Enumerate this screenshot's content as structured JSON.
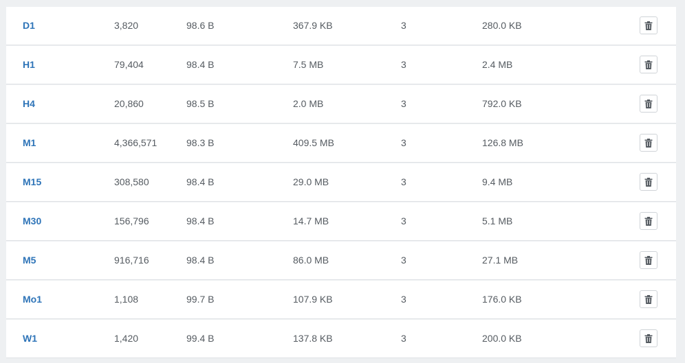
{
  "icons": {
    "delete": "trash-icon"
  },
  "rows": [
    {
      "name": "D1",
      "count": "3,820",
      "avg": "98.6 B",
      "size": "367.9 KB",
      "replicas": "3",
      "disk": "280.0 KB"
    },
    {
      "name": "H1",
      "count": "79,404",
      "avg": "98.4 B",
      "size": "7.5 MB",
      "replicas": "3",
      "disk": "2.4 MB"
    },
    {
      "name": "H4",
      "count": "20,860",
      "avg": "98.5 B",
      "size": "2.0 MB",
      "replicas": "3",
      "disk": "792.0 KB"
    },
    {
      "name": "M1",
      "count": "4,366,571",
      "avg": "98.3 B",
      "size": "409.5 MB",
      "replicas": "3",
      "disk": "126.8 MB"
    },
    {
      "name": "M15",
      "count": "308,580",
      "avg": "98.4 B",
      "size": "29.0 MB",
      "replicas": "3",
      "disk": "9.4 MB"
    },
    {
      "name": "M30",
      "count": "156,796",
      "avg": "98.4 B",
      "size": "14.7 MB",
      "replicas": "3",
      "disk": "5.1 MB"
    },
    {
      "name": "M5",
      "count": "916,716",
      "avg": "98.4 B",
      "size": "86.0 MB",
      "replicas": "3",
      "disk": "27.1 MB"
    },
    {
      "name": "Mo1",
      "count": "1,108",
      "avg": "99.7 B",
      "size": "107.9 KB",
      "replicas": "3",
      "disk": "176.0 KB"
    },
    {
      "name": "W1",
      "count": "1,420",
      "avg": "99.4 B",
      "size": "137.8 KB",
      "replicas": "3",
      "disk": "200.0 KB"
    }
  ]
}
